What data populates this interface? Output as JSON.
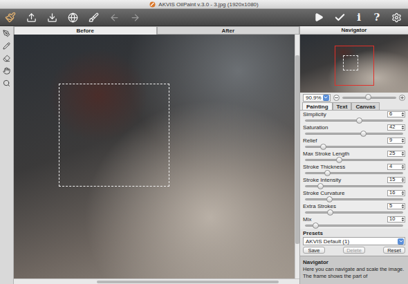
{
  "window": {
    "title": "AKVIS OilPaint v.3.0 - 3.jpg (1920x1080)"
  },
  "toolbar": {
    "undo_disabled": true,
    "redo_disabled": true,
    "glyphs": [
      "i",
      "?"
    ]
  },
  "view_tabs": [
    {
      "label": "Before",
      "selected": true
    },
    {
      "label": "After",
      "selected": false
    }
  ],
  "navigator": {
    "title": "Navigator",
    "zoom": "90.9%",
    "zoom_level": 0.48
  },
  "settings_tabs": [
    {
      "label": "Painting",
      "selected": true
    },
    {
      "label": "Text",
      "selected": false
    },
    {
      "label": "Canvas",
      "selected": false
    }
  ],
  "parameters": [
    {
      "label": "Simplicity",
      "value": "6",
      "level": 0.55
    },
    {
      "label": "Saturation",
      "value": "42",
      "level": 0.59
    },
    {
      "label": "Relief",
      "value": "9",
      "level": 0.18
    },
    {
      "label": "Max Stroke Length",
      "value": "25",
      "level": 0.34
    },
    {
      "label": "Stroke Thickness",
      "value": "4",
      "level": 0.22
    },
    {
      "label": "Stroke Intensity",
      "value": "15",
      "level": 0.15
    },
    {
      "label": "Stroke Curvature",
      "value": "16",
      "level": 0.24
    },
    {
      "label": "Extra Strokes",
      "value": "5",
      "level": 0.25
    },
    {
      "label": "Mix",
      "value": "10",
      "level": 0.1
    }
  ],
  "presets": {
    "label": "Presets",
    "value": "AKVIS Default (1)",
    "buttons": [
      {
        "label": "Save",
        "disabled": false
      },
      {
        "label": "Delete",
        "disabled": true
      },
      {
        "label": "Reset",
        "disabled": false
      }
    ]
  },
  "help": {
    "title": "Navigator",
    "text": "Here you can navigate and scale the image. The frame shows the part of"
  }
}
